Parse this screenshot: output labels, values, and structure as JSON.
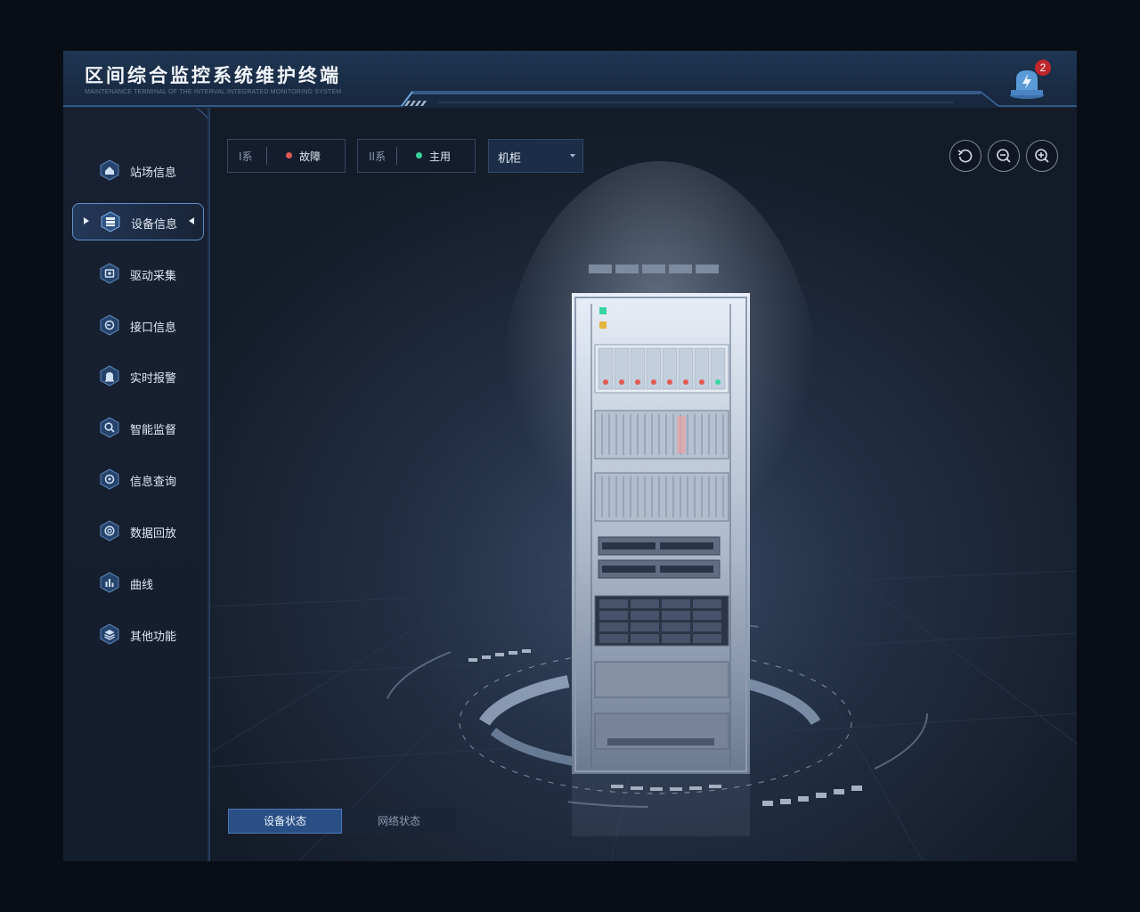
{
  "header": {
    "title": "区间综合监控系统维护终端",
    "subtitle": "MAINTENANCE TERMINAL OF THE INTERVAL INTEGRATED MONITORING SYSTEM",
    "alarm_icon": "alarm-light-icon",
    "alarm_count": "2"
  },
  "sidebar": {
    "items": [
      {
        "label": "站场信息",
        "icon": "home-icon"
      },
      {
        "label": "设备信息",
        "icon": "device-icon",
        "active": true
      },
      {
        "label": "驱动采集",
        "icon": "driver-icon"
      },
      {
        "label": "接口信息",
        "icon": "interface-icon"
      },
      {
        "label": "实时报警",
        "icon": "alarm-icon"
      },
      {
        "label": "智能监督",
        "icon": "monitor-icon"
      },
      {
        "label": "信息查询",
        "icon": "query-icon"
      },
      {
        "label": "数据回放",
        "icon": "replay-icon"
      },
      {
        "label": "曲线",
        "icon": "chart-icon"
      },
      {
        "label": "其他功能",
        "icon": "layers-icon"
      }
    ]
  },
  "toolbar": {
    "system1": {
      "name": "I系",
      "state": "故障",
      "color": "#e05a55"
    },
    "system2": {
      "name": "II系",
      "state": "主用",
      "color": "#35d39a"
    },
    "select_value": "机柜",
    "buttons": [
      "reset-icon",
      "zoom-out-icon",
      "zoom-in-icon"
    ]
  },
  "tabs": {
    "device_status": "设备状态",
    "network_status": "网络状态"
  },
  "colors": {
    "accent": "#2a4f85",
    "fault": "#e05a55",
    "active": "#35d39a",
    "badge": "#c0272d"
  }
}
